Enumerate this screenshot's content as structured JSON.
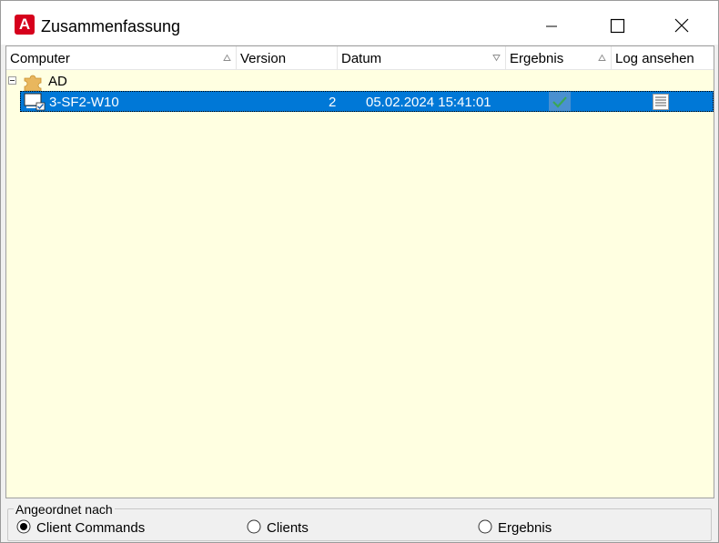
{
  "window": {
    "title": "Zusammenfassung"
  },
  "table": {
    "columns": [
      {
        "label": "Computer",
        "sort": "up"
      },
      {
        "label": "Version",
        "sort": ""
      },
      {
        "label": "Datum",
        "sort": "down"
      },
      {
        "label": "Ergebnis",
        "sort": "up"
      },
      {
        "label": "Log ansehen",
        "sort": ""
      }
    ],
    "group": {
      "name": "AD",
      "icon": "puzzle-icon",
      "expanded": true
    },
    "rows": [
      {
        "computer": "3-SF2-W10",
        "version": "2",
        "datum": "05.02.2024 15:41:01",
        "ergebnis": "check-icon",
        "log": "document-icon"
      }
    ]
  },
  "arrange": {
    "label": "Angeordnet nach",
    "options": [
      {
        "label": "Client Commands",
        "selected": true
      },
      {
        "label": "Clients",
        "selected": false
      },
      {
        "label": "Ergebnis",
        "selected": false
      }
    ]
  },
  "colors": {
    "selection": "#0078d7",
    "list_background": "#ffffe1",
    "brand": "#d6001c"
  }
}
